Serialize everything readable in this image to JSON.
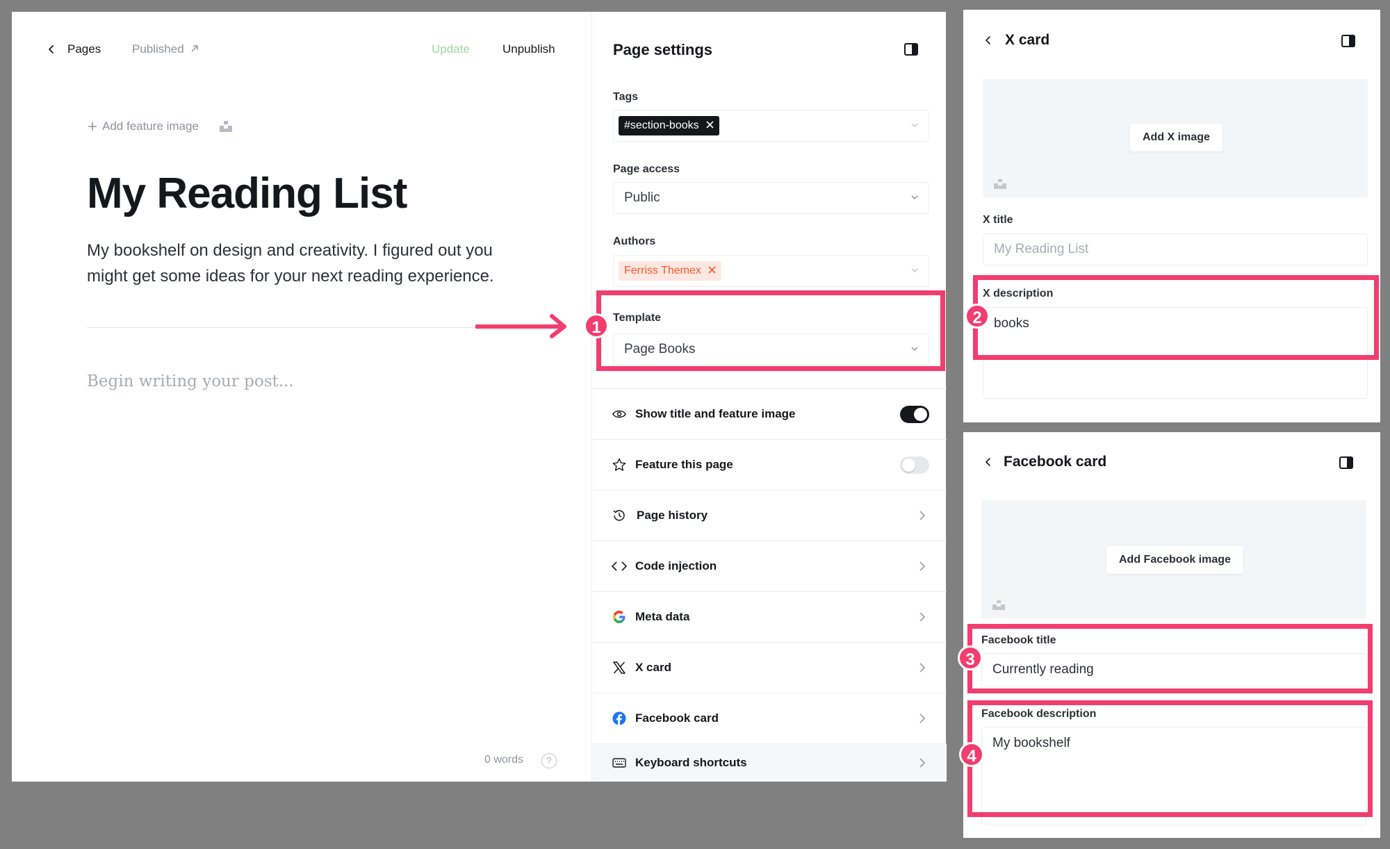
{
  "editor": {
    "back_label": "Pages",
    "status_label": "Published",
    "update_label": "Update",
    "unpublish_label": "Unpublish",
    "add_feature_label": "Add feature image",
    "title": "My Reading List",
    "excerpt": "My bookshelf on design and creativity. I figured out you might get some ideas for your next reading experience.",
    "body_placeholder": "Begin writing your post...",
    "word_count": "0 words",
    "help_glyph": "?"
  },
  "settings": {
    "title": "Page settings",
    "tags_label": "Tags",
    "tag": "#section-books",
    "access_label": "Page access",
    "access_value": "Public",
    "authors_label": "Authors",
    "author": "Ferriss Themex",
    "template_label": "Template",
    "template_value": "Page Books",
    "rows": [
      {
        "label": "Show title and feature image",
        "icon": "eye-icon",
        "toggle": true
      },
      {
        "label": "Feature this page",
        "icon": "star-icon",
        "toggle": false
      },
      {
        "label": "Page history",
        "icon": "history-icon"
      },
      {
        "label": "Code injection",
        "icon": "code-icon"
      },
      {
        "label": "Meta data",
        "icon": "google-icon"
      },
      {
        "label": "X card",
        "icon": "x-logo-icon"
      },
      {
        "label": "Facebook card",
        "icon": "facebook-icon"
      },
      {
        "label": "Keyboard shortcuts",
        "icon": "keyboard-icon"
      }
    ]
  },
  "x_card": {
    "title": "X card",
    "add_image_label": "Add X image",
    "title_label": "X title",
    "title_placeholder": "My Reading List",
    "description_label": "X description",
    "description_value": "books"
  },
  "facebook_card": {
    "title": "Facebook card",
    "add_image_label": "Add Facebook image",
    "title_label": "Facebook title",
    "title_value": "Currently reading",
    "description_label": "Facebook description",
    "description_value": "My bookshelf"
  },
  "annotations": [
    "1",
    "2",
    "3",
    "4"
  ],
  "colors": {
    "highlight": "#f23d6f",
    "author_chip_bg": "#fde8e1",
    "author_chip_text": "#f25a2c",
    "update_green": "#a0d7a0",
    "facebook_blue": "#1877f2"
  }
}
